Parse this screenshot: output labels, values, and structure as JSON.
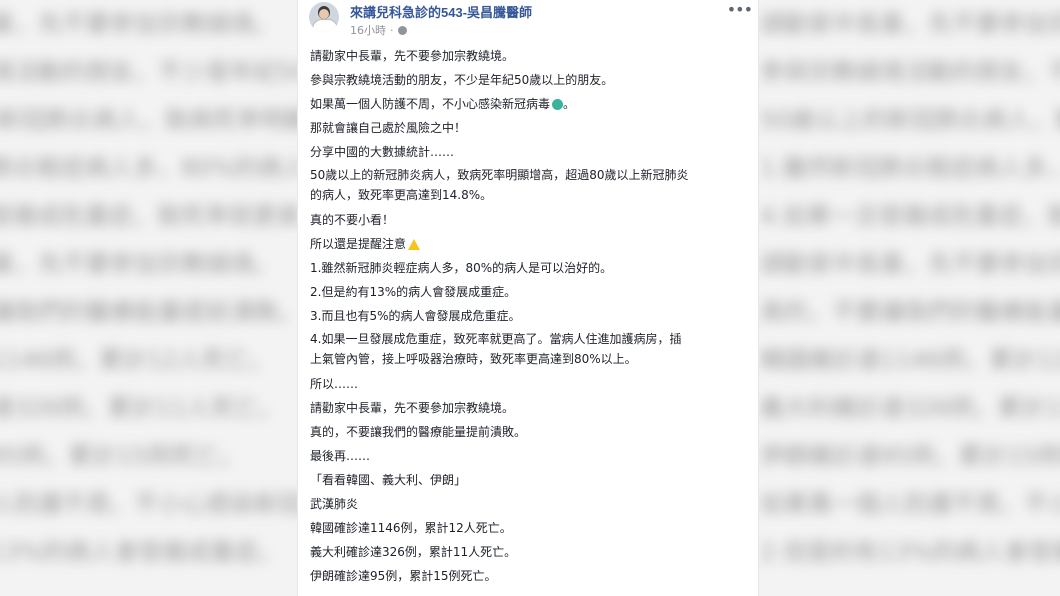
{
  "post": {
    "page_name": "來講兒科急診的543-吳昌騰醫師",
    "time": "16小時",
    "paragraphs": [
      "請勸家中長輩，先不要參加宗教繞境。",
      "參與宗教繞境活動的朋友，不少是年紀50歲以上的朋友。",
      "如果萬一個人防護不周，不小心感染新冠病毒",
      "那就會讓自己處於風險之中！",
      "分享中國的大數據統計……",
      "50歲以上的新冠肺炎病人，致病死率明顯增高，超過80歲以上新冠肺炎\n的病人，致死率更高達到14.8%。",
      "真的不要小看！",
      "所以還是提醒注意",
      "1.雖然新冠肺炎輕症病人多，80%的病人是可以治好的。",
      "2.但是約有13%的病人會發展成重症。",
      "3.而且也有5%的病人會發展成危重症。",
      "4.如果一旦發展成危重症，致死率就更高了。當病人住進加護病房，插\n上氣管內管，接上呼吸器治療時，致死率更高達到80%以上。",
      "所以……",
      "請勸家中長輩，先不要參加宗教繞境。",
      "真的，不要讓我們的醫療能量提前潰敗。",
      "最後再……",
      "「看看韓國、義大利、伊朗」",
      "武漢肺炎",
      "韓國確診達1146例，累計12人死亡。",
      "義大利確診達326例，累計11人死亡。",
      "伊朗確診達95例，累計15例死亡。"
    ],
    "suffix_period": "。"
  },
  "icons": {
    "globe": "globe-icon",
    "more": "more-options-icon",
    "virus": "virus-emoji-icon",
    "warning": "warning-emoji-icon"
  },
  "colors": {
    "page_name": "#365899",
    "meta": "#90949c",
    "text": "#1d2129"
  }
}
